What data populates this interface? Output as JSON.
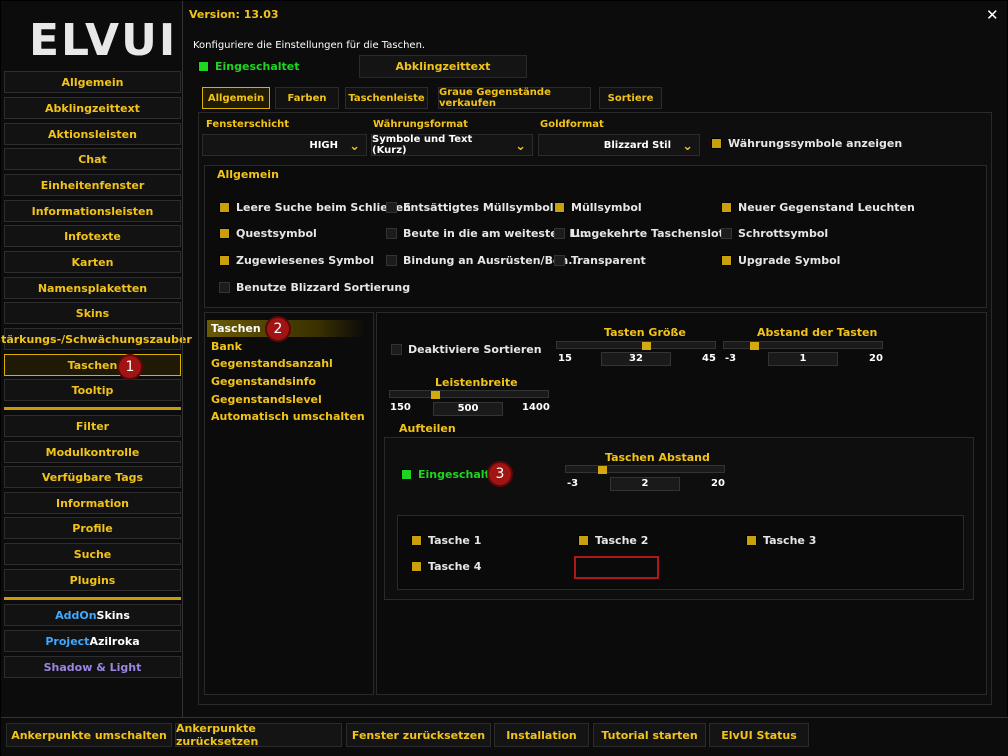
{
  "app": {
    "logo": "ELVUI",
    "version": "Version: 13.03",
    "description": "Konfiguriere die Einstellungen für die Taschen.",
    "close_icon": "✕"
  },
  "sidebar": {
    "items": [
      "Allgemein",
      "Abklingzeittext",
      "Aktionsleisten",
      "Chat",
      "Einheitenfenster",
      "Informationsleisten",
      "Infotexte",
      "Karten",
      "Namensplaketten",
      "Skins",
      "Stärkungs-/Schwächungszauber",
      "Taschen",
      "Tooltip"
    ],
    "items2": [
      "Filter",
      "Modulkontrolle",
      "Verfügbare Tags",
      "Information",
      "Profile",
      "Suche",
      "Plugins"
    ],
    "plugins": {
      "addonskins_a": "AddOn",
      "addonskins_b": "Skins",
      "azil_a": "Project",
      "azil_b": "Azilroka",
      "shadow": "Shadow & Light"
    }
  },
  "header": {
    "enabled_label": "Eingeschaltet",
    "cooldown_button": "Abklingzeittext"
  },
  "tabs": [
    "Allgemein",
    "Farben",
    "Taschenleiste",
    "Graue Gegenstände verkaufen",
    "Sortiere"
  ],
  "general": {
    "strata_label": "Fensterschicht",
    "strata_value": "HIGH",
    "currency_label": "Währungsformat",
    "currency_value": "Symbole und Text (Kurz)",
    "gold_label": "Goldformat",
    "gold_value": "Blizzard Stil",
    "currency_icons": "Währungssymbole anzeigen",
    "section": "Allgemein",
    "options": [
      "Leere Suche beim Schließen",
      "Entsättigtes Müllsymbol",
      "Müllsymbol",
      "Neuer Gegenstand Leuchten",
      "Questsymbol",
      "Beute in die am weitesten L...",
      "Umgekehrte Taschenslots",
      "Schrottsymbol",
      "Zugewiesenes Symbol",
      "Bindung an Ausrüsten/Ben...",
      "Transparent",
      "Upgrade Symbol",
      "Benutze Blizzard Sortierung"
    ]
  },
  "tree": [
    "Taschen",
    "Bank",
    "Gegenstandsanzahl",
    "Gegenstandsinfo",
    "Gegenstandslevel",
    "Automatisch umschalten"
  ],
  "bags": {
    "disable_sort": "Deaktiviere Sortieren",
    "size": {
      "label": "Tasten Größe",
      "min": "15",
      "value": "32",
      "max": "45"
    },
    "spacing": {
      "label": "Abstand der Tasten",
      "min": "-3",
      "value": "1",
      "max": "20"
    },
    "width": {
      "label": "Leistenbreite",
      "min": "150",
      "value": "500",
      "max": "1400"
    },
    "split": {
      "section": "Aufteilen",
      "enabled": "Eingeschaltet",
      "spacing_label": "Taschen Abstand",
      "min": "-3",
      "value": "2",
      "max": "20",
      "bags": [
        "Tasche 1",
        "Tasche 2",
        "Tasche 3",
        "Tasche 4"
      ]
    }
  },
  "badges": [
    "1",
    "2",
    "3"
  ],
  "footer": [
    "Ankerpunkte umschalten",
    "Ankerpunkte zurücksetzen",
    "Fenster zurücksetzen",
    "Installation",
    "Tutorial starten",
    "ElvUI Status"
  ],
  "colors": {
    "accent": "#f2c318",
    "enabled": "#1fd61f",
    "badge": "#a01414"
  }
}
